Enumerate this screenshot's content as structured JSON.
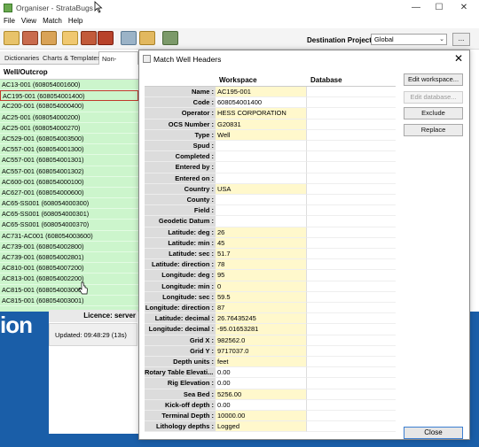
{
  "window": {
    "title": "Organiser - StrataBugs"
  },
  "menu": [
    "File",
    "View",
    "Match",
    "Help"
  ],
  "toolbar": {
    "destination_label": "Destination Project:",
    "destination_value": "Global",
    "more_label": "..."
  },
  "tabs": [
    "Dictionaries",
    "Charts & Templates",
    "Non-version"
  ],
  "list": {
    "header": "Well/Outcrop",
    "items": [
      "AC13-001 (608054001600)",
      "AC195-001 (608054001400)",
      "AC200-001 (608054000400)",
      "AC25-001 (608054000200)",
      "AC25-001 (608054000270)",
      "AC529-001 (608054003500)",
      "AC557-001 (608054001300)",
      "AC557-001 (608054001301)",
      "AC557-001 (608054001302)",
      "AC600-001 (608054000100)",
      "AC627-001 (608054000600)",
      "AC65-SS001 (608054000300)",
      "AC65-SS001 (608054000301)",
      "AC65-SS001 (608054000370)",
      "AC731-AC001 (608054003600)",
      "AC739-001 (608054002800)",
      "AC739-001 (608054002801)",
      "AC810-001 (608054007200)",
      "AC813-001 (608054002200)",
      "AC815-001 (608054003000)",
      "AC815-001 (608054003001)"
    ],
    "selected_index": 1
  },
  "status": {
    "licence": "Licence: server",
    "updated": "Updated: 09:48:29 (13s)"
  },
  "background_text": "ion",
  "dialog": {
    "title": "Match Well Headers",
    "columns": {
      "workspace": "Workspace",
      "database": "Database"
    },
    "fields": [
      {
        "label": "Name :",
        "value": "AC195-001",
        "hl": true
      },
      {
        "label": "Code :",
        "value": "608054001400",
        "hl": false
      },
      {
        "label": "Operator :",
        "value": "HESS CORPORATION",
        "hl": true
      },
      {
        "label": "OCS Number :",
        "value": "G20831",
        "hl": true
      },
      {
        "label": "Type :",
        "value": "Well",
        "hl": true
      },
      {
        "label": "Spud :",
        "value": "",
        "hl": false
      },
      {
        "label": "Completed :",
        "value": "",
        "hl": false
      },
      {
        "label": "Entered by :",
        "value": "",
        "hl": false
      },
      {
        "label": "Entered on :",
        "value": "",
        "hl": false
      },
      {
        "label": "Country :",
        "value": "USA",
        "hl": true
      },
      {
        "label": "County :",
        "value": "",
        "hl": false
      },
      {
        "label": "Field :",
        "value": "",
        "hl": false
      },
      {
        "label": "Geodetic Datum :",
        "value": "",
        "hl": false
      },
      {
        "label": "Latitude: deg :",
        "value": "26",
        "hl": true
      },
      {
        "label": "Latitude: min :",
        "value": "45",
        "hl": true
      },
      {
        "label": "Latitude: sec :",
        "value": "51.7",
        "hl": true
      },
      {
        "label": "Latitude: direction :",
        "value": "78",
        "hl": true
      },
      {
        "label": "Longitude: deg :",
        "value": "95",
        "hl": true
      },
      {
        "label": "Longitude: min :",
        "value": "0",
        "hl": true
      },
      {
        "label": "Longitude: sec :",
        "value": "59.5",
        "hl": true
      },
      {
        "label": "Longitude: direction :",
        "value": "87",
        "hl": true
      },
      {
        "label": "Latitude: decimal :",
        "value": "26.76435245",
        "hl": true
      },
      {
        "label": "Longitude: decimal :",
        "value": "-95.01653281",
        "hl": true
      },
      {
        "label": "Grid X :",
        "value": "982562.0",
        "hl": true
      },
      {
        "label": "Grid Y :",
        "value": "9717037.0",
        "hl": true
      },
      {
        "label": "Depth units :",
        "value": "feet",
        "hl": true
      },
      {
        "label": "Rotary Table Elevati... :",
        "value": "0.00",
        "hl": false
      },
      {
        "label": "Rig Elevation :",
        "value": "0.00",
        "hl": false
      },
      {
        "label": "Sea Bed :",
        "value": "5256.00",
        "hl": true
      },
      {
        "label": "Kick-off depth :",
        "value": "0.00",
        "hl": false
      },
      {
        "label": "Terminal Depth :",
        "value": "10000.00",
        "hl": true
      },
      {
        "label": "Lithology depths :",
        "value": "Logged",
        "hl": true
      }
    ],
    "buttons": {
      "edit_workspace": "Edit workspace...",
      "edit_database": "Edit database...",
      "exclude": "Exclude",
      "replace": "Replace",
      "close": "Close"
    }
  },
  "colors": {
    "list_bg": "#ccf5cc",
    "field_highlight": "#fff8cc",
    "accent_blue": "#1a5ea8"
  }
}
